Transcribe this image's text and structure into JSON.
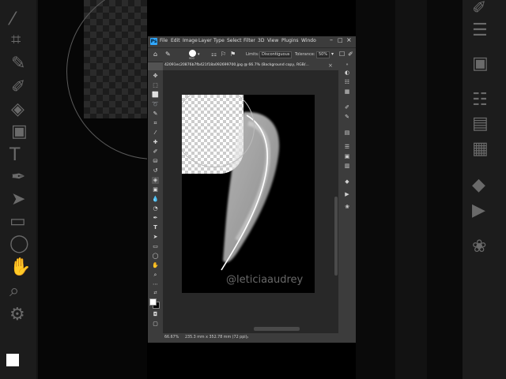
{
  "app": {
    "logo": "Ps"
  },
  "menubar": {
    "items": [
      "File",
      "Edit",
      "Image",
      "Layer",
      "Type",
      "Select",
      "Filter",
      "3D",
      "View",
      "Plugins",
      "Windo"
    ]
  },
  "options": {
    "brush_size": "900",
    "limits_label": "Limits:",
    "limits_value": "Discontiguous",
    "tolerance_label": "Tolerance:",
    "tolerance_value": "50%"
  },
  "document": {
    "tab_title": "42091ec20876b7fb421f18a092699700.jpg @ 66.7% (Background copy, RGB/...",
    "watermark": "@leticiaaudrey",
    "zoom": "66.67%",
    "dimensions": "235.3 mm x 352.78 mm (72 ppi)"
  },
  "colors": {
    "ps_blue": "#31a8ff",
    "ui_dark": "#3c3c3c",
    "workspace": "#282828"
  },
  "tools": [
    "move-icon",
    "artboard-icon",
    "marquee-icon",
    "lasso-icon",
    "quick-select-icon",
    "crop-icon",
    "eyedropper-icon",
    "healing-icon",
    "brush-icon",
    "stamp-icon",
    "history-brush-icon",
    "eraser-icon",
    "gradient-icon",
    "blur-icon",
    "dodge-icon",
    "pen-icon",
    "type-icon",
    "path-select-icon",
    "rectangle-icon",
    "hand-icon",
    "zoom-icon"
  ],
  "panels": [
    "layers-icon",
    "channels-icon",
    "paths-icon",
    "adjustments-icon",
    "properties-icon",
    "libraries-icon",
    "history-icon",
    "actions-icon"
  ]
}
